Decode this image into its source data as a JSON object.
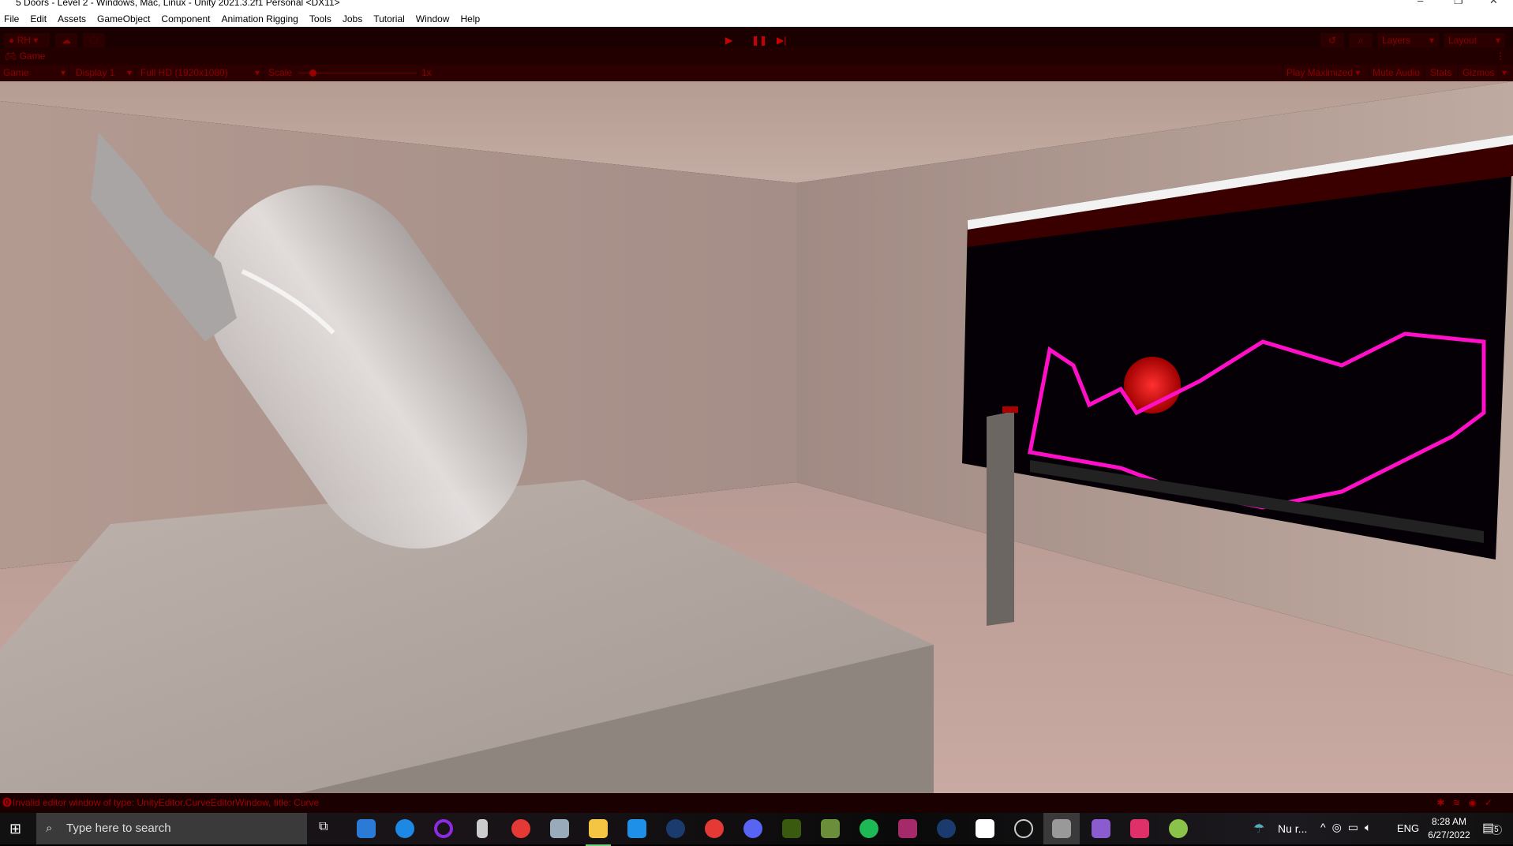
{
  "window": {
    "title": "5 Doors - Level 2 - Windows, Mac, Linux - Unity 2021.3.2f1 Personal <DX11>"
  },
  "menu": [
    "File",
    "Edit",
    "Assets",
    "GameObject",
    "Component",
    "Animation Rigging",
    "Tools",
    "Jobs",
    "Tutorial",
    "Window",
    "Help"
  ],
  "toolbar": {
    "account": "RH",
    "layers": "Layers",
    "layout": "Layout"
  },
  "game_tab": {
    "label": "Game"
  },
  "game_bar": {
    "view": "Game",
    "display": "Display 1",
    "resolution": "Full HD (1920x1080)",
    "scale_label": "Scale",
    "scale_value": "1x",
    "play_maximized": "Play Maximized",
    "mute_audio": "Mute Audio",
    "stats": "Stats",
    "gizmos": "Gizmos"
  },
  "status": {
    "message": "Invalid editor window of type: UnityEditor.CurveEditorWindow, title: Curve"
  },
  "taskbar": {
    "search_placeholder": "Type here to search",
    "weather": "Nu r...",
    "language": "ENG",
    "time": "8:28 AM",
    "date": "6/27/2022",
    "notifications": "5"
  },
  "colors": {
    "accent": "#8a0000",
    "toolbar_bg": "#1a0000"
  }
}
